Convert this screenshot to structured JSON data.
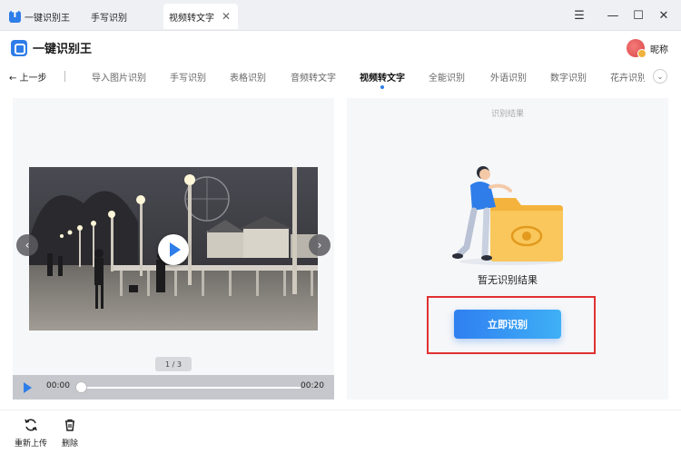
{
  "window": {
    "tabs": [
      {
        "label": "一键识别王"
      },
      {
        "label": "手写识别"
      },
      {
        "label": "视频转文字"
      }
    ],
    "controls": {
      "menu": "☰",
      "minimize": "—",
      "maximize": "☐",
      "close": "✕"
    }
  },
  "app": {
    "name": "一键识别王",
    "user_name": "昵称"
  },
  "nav": {
    "back_label": "← 上一步",
    "items": [
      "导入图片识别",
      "手写识别",
      "表格识别",
      "音频转文字",
      "视频转文字",
      "全能识别",
      "外语识别",
      "数字识别",
      "花卉识别"
    ],
    "active": "视频转文字"
  },
  "player": {
    "page_indicator": "1 / 3",
    "current_time": "00:00",
    "duration": "00:20",
    "progress": 0
  },
  "result": {
    "title": "识别结果",
    "empty_text": "暂无识别结果",
    "button_label": "立即识别"
  },
  "toolbar": {
    "reupload_label": "重新上传",
    "delete_label": "删除"
  },
  "colors": {
    "accent": "#2e7de8",
    "highlight_border": "#e03131"
  }
}
